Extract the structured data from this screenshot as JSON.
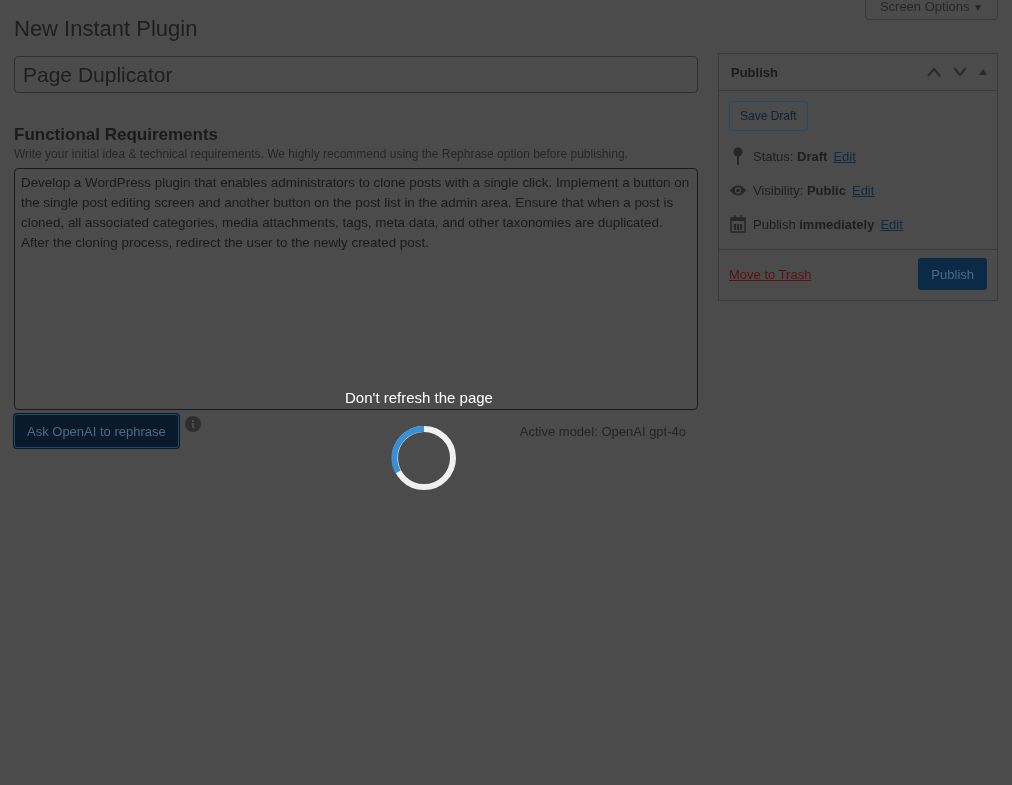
{
  "screen_options": {
    "label": "Screen Options",
    "caret": "▼"
  },
  "page_title": "New Instant Plugin",
  "title_field": {
    "value": "Page Duplicator"
  },
  "requirements": {
    "heading": "Functional Requirements",
    "hint": "Write your initial idea & technical requirements. We highly recommend using the Rephrase option before publishing.",
    "value": "Develop a WordPress plugin that enables administrators to clone posts with a single click. Implement a button on the single post editing screen and another button on the post list in the admin area. Ensure that when a post is cloned, all associated categories, media attachments, tags, meta data, and other taxonomies are duplicated. After the cloning process, redirect the user to the newly created post."
  },
  "rephrase_button": "Ask OpenAI to rephrase",
  "active_model": "Active model: OpenAI gpt-4o",
  "publish_box": {
    "title": "Publish",
    "save_draft": "Save Draft",
    "rows": [
      {
        "kind": "status",
        "text": "Status: **Draft**",
        "link": "Edit"
      },
      {
        "kind": "visibility",
        "text": "Visibility: **Public**",
        "link": "Edit"
      },
      {
        "kind": "schedule",
        "text": "Publish **immediately**",
        "link": "Edit"
      }
    ],
    "trash": "Move to Trash",
    "publish": "Publish"
  },
  "overlay": {
    "message": "Don't refresh the page"
  }
}
